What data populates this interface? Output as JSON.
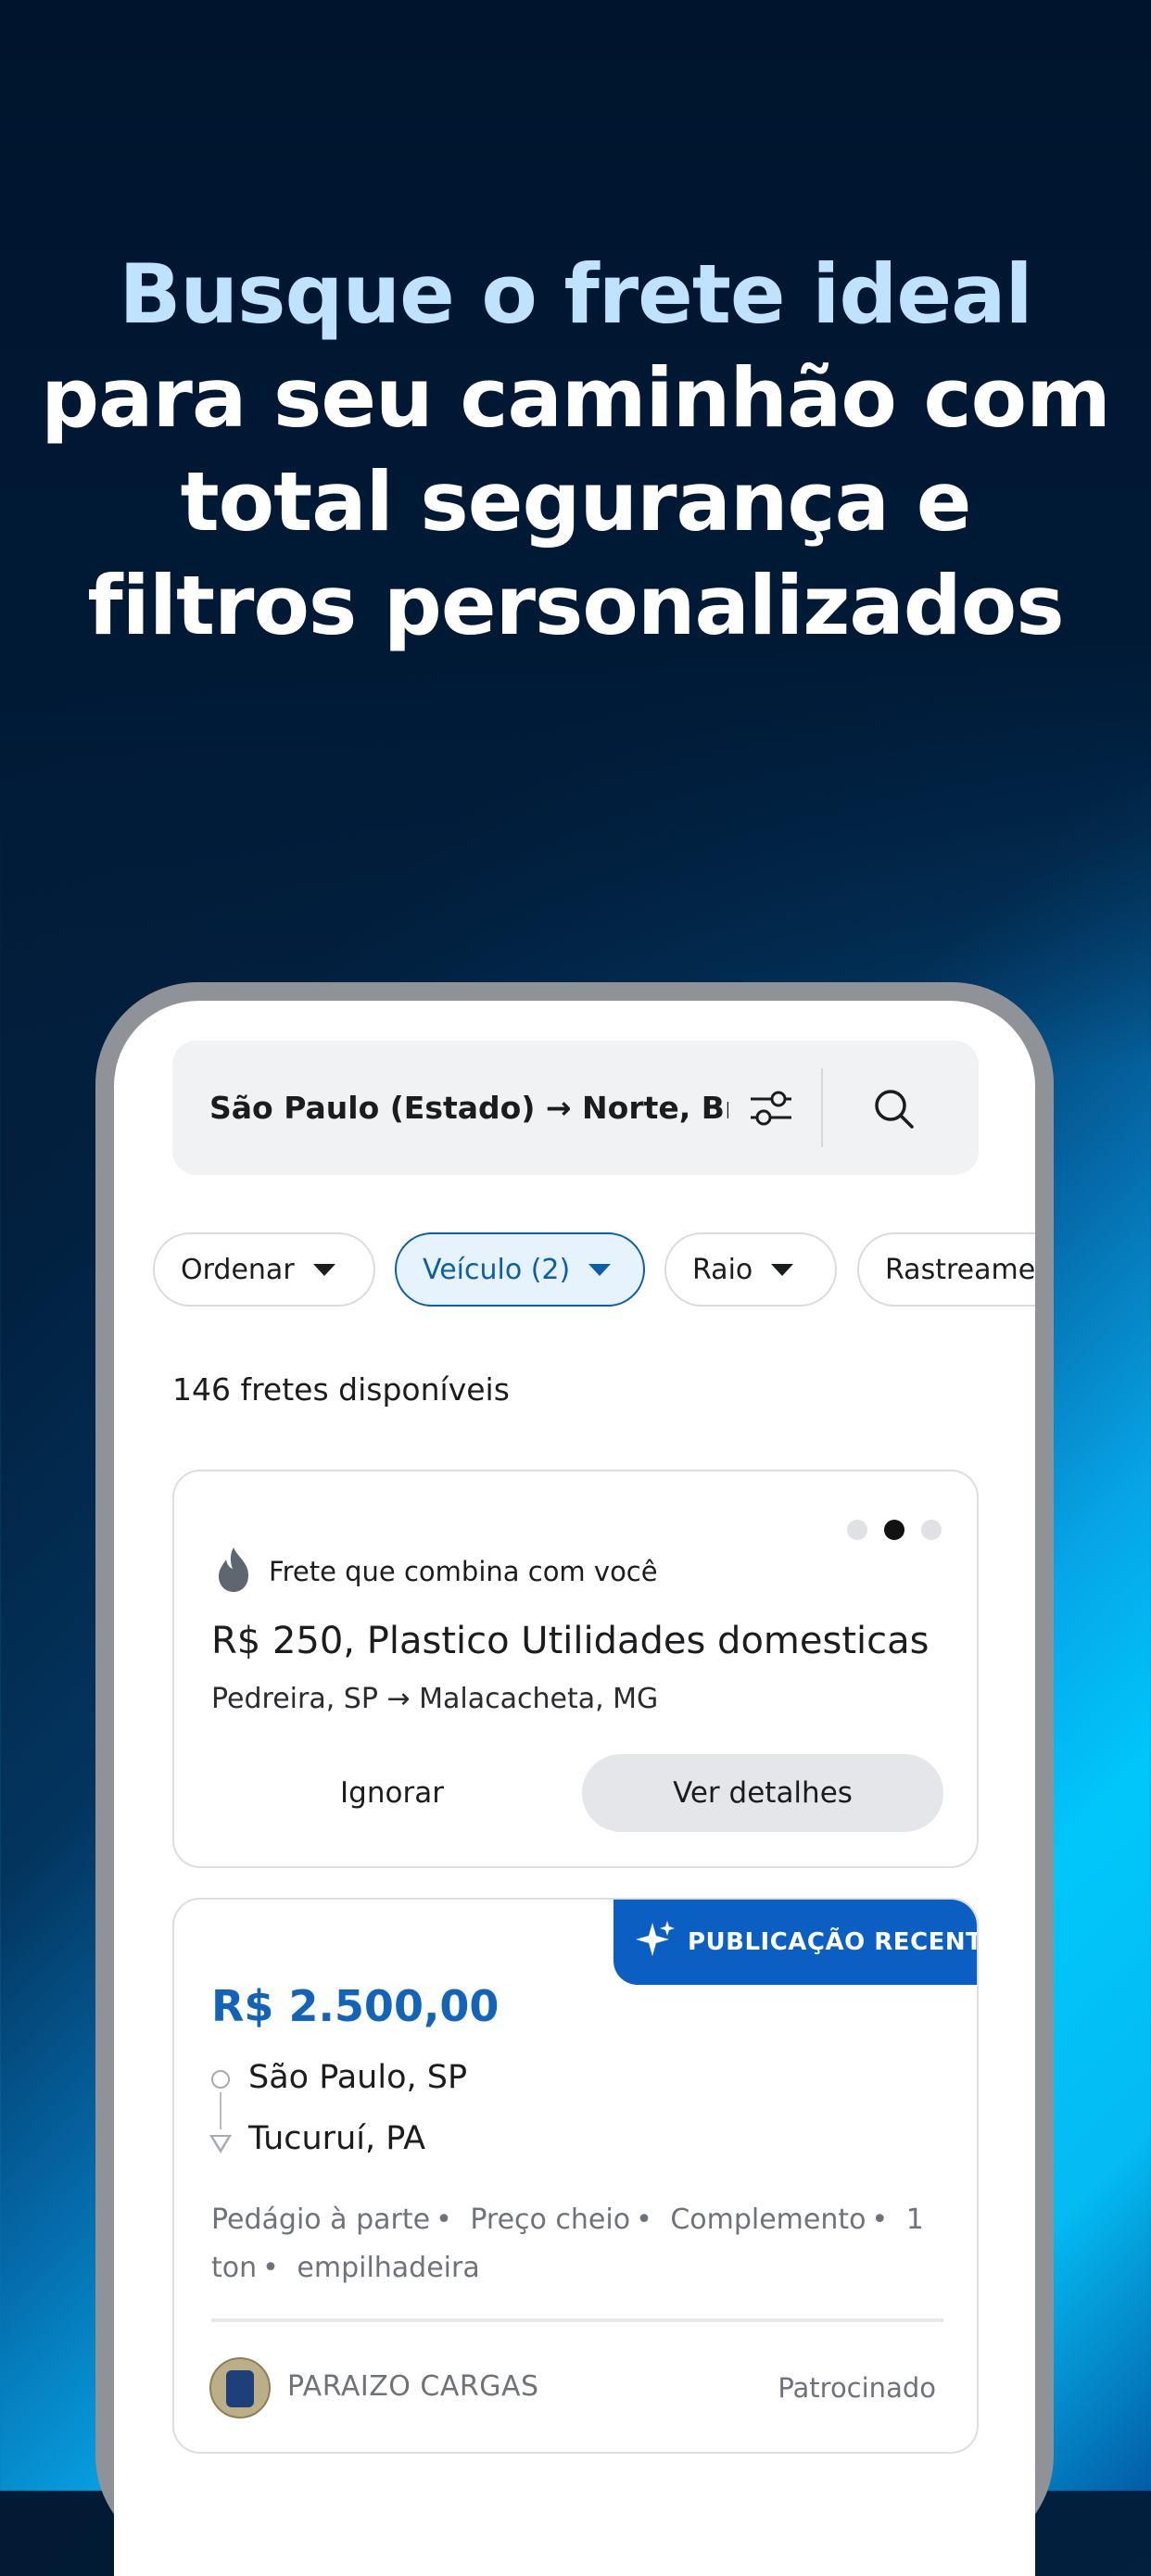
{
  "headline": {
    "highlight": "Busque o frete ideal",
    "rest": "para seu caminhão com total segurança e filtros personalizados"
  },
  "search": {
    "query": "São Paulo (Estado) → Norte, Br...",
    "filter_icon": "sliders-icon",
    "search_icon": "search-icon"
  },
  "chips": [
    {
      "label": "Ordenar",
      "active": false
    },
    {
      "label": "Veículo (2)",
      "active": true
    },
    {
      "label": "Raio",
      "active": false
    },
    {
      "label": "Rastreamen",
      "active": false
    }
  ],
  "results": {
    "count_text": "146 fretes disponíveis"
  },
  "match_card": {
    "tag": "Frete que combina com você",
    "tag_icon": "flame-icon",
    "title": "R$ 250, Plastico Utilidades domesticas",
    "route": "Pedreira, SP → Malacacheta, MG",
    "ignore_label": "Ignorar",
    "details_label": "Ver detalhes",
    "pager": {
      "total": 3,
      "active_index": 1
    }
  },
  "freight_card": {
    "badge": "PUBLICAÇÃO RECENTE",
    "badge_icon": "sparkle-icon",
    "price": "R$ 2.500,00",
    "origin": "São Paulo, SP",
    "destination": "Tucuruí, PA",
    "tags": [
      "Pedágio à parte",
      "Preço cheio",
      "Complemento",
      "1 ton",
      "empilhadeira"
    ],
    "company": "PARAIZO CARGAS",
    "sponsored": "Patrocinado"
  },
  "colors": {
    "accent_blue": "#1363b8",
    "badge_blue": "#0c5fc2",
    "headline_highlight": "#bfe2ff"
  }
}
